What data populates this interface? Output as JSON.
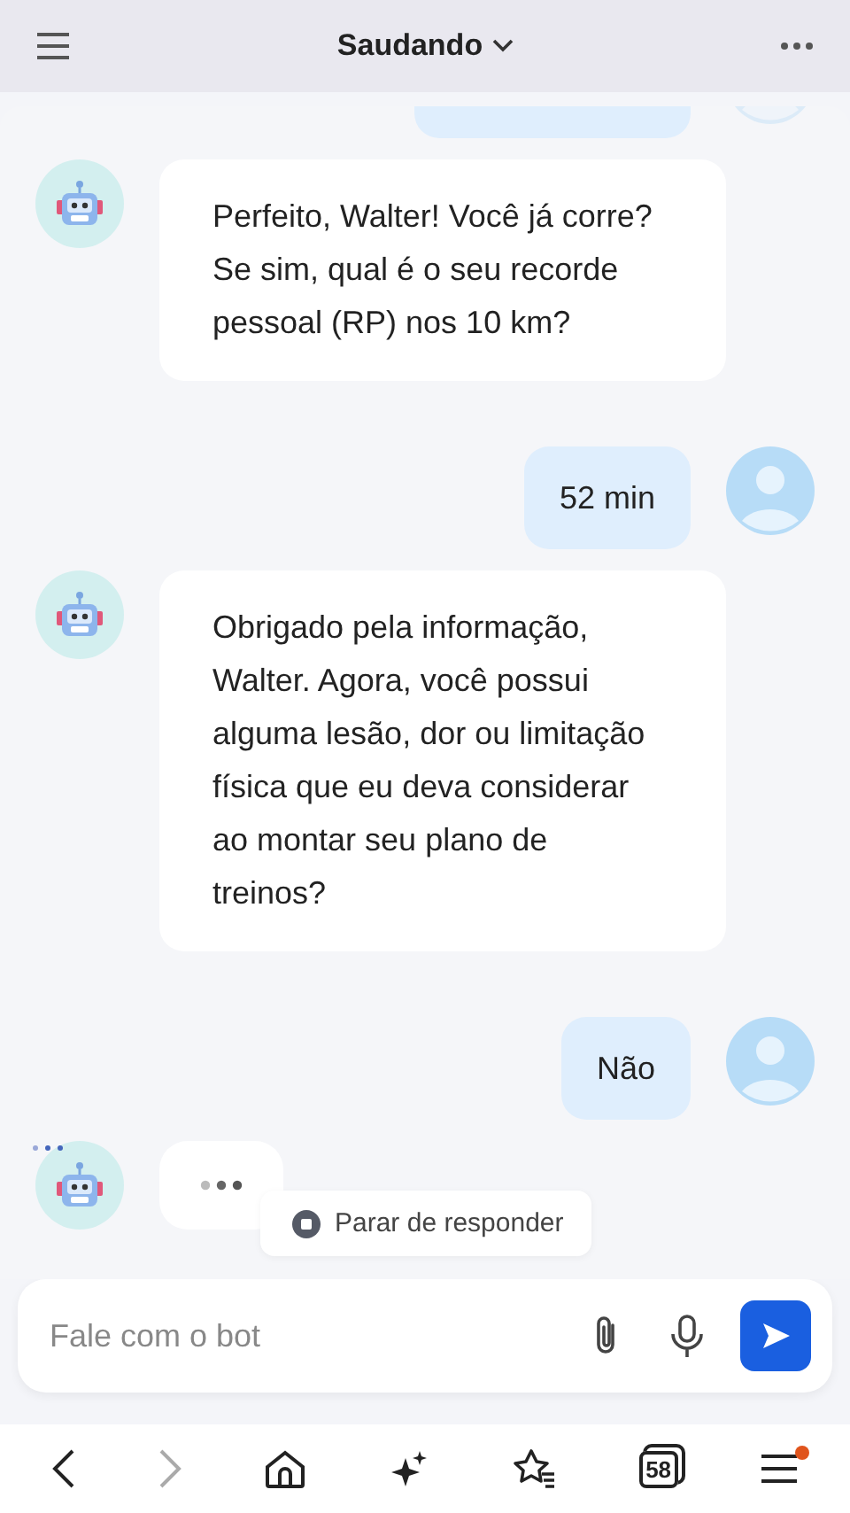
{
  "header": {
    "title": "Saudando"
  },
  "messages": [
    {
      "kind": "user",
      "cut": true
    },
    {
      "kind": "bot",
      "text": "Perfeito, Walter! Você já corre? Se sim, qual é o seu recorde pessoal (RP) nos 10 km?"
    },
    {
      "kind": "user",
      "text": "52 min"
    },
    {
      "kind": "bot",
      "text": "Obrigado pela informação, Walter. Agora, você possui alguma lesão, dor ou limitação física que eu deva considerar ao montar seu plano de treinos?"
    },
    {
      "kind": "user",
      "text": "Não"
    },
    {
      "kind": "typing"
    }
  ],
  "stop_button": {
    "label": "Parar de responder"
  },
  "composer": {
    "placeholder": "Fale com o bot"
  },
  "nav": [
    {
      "kind": "back",
      "disabled": false
    },
    {
      "kind": "forward",
      "disabled": true
    },
    {
      "kind": "home",
      "disabled": false
    },
    {
      "kind": "sparkle",
      "disabled": false
    },
    {
      "kind": "bookmarks",
      "disabled": false
    },
    {
      "kind": "tabs",
      "count": "58",
      "disabled": false
    },
    {
      "kind": "menu",
      "disabled": false,
      "badge": true
    }
  ]
}
